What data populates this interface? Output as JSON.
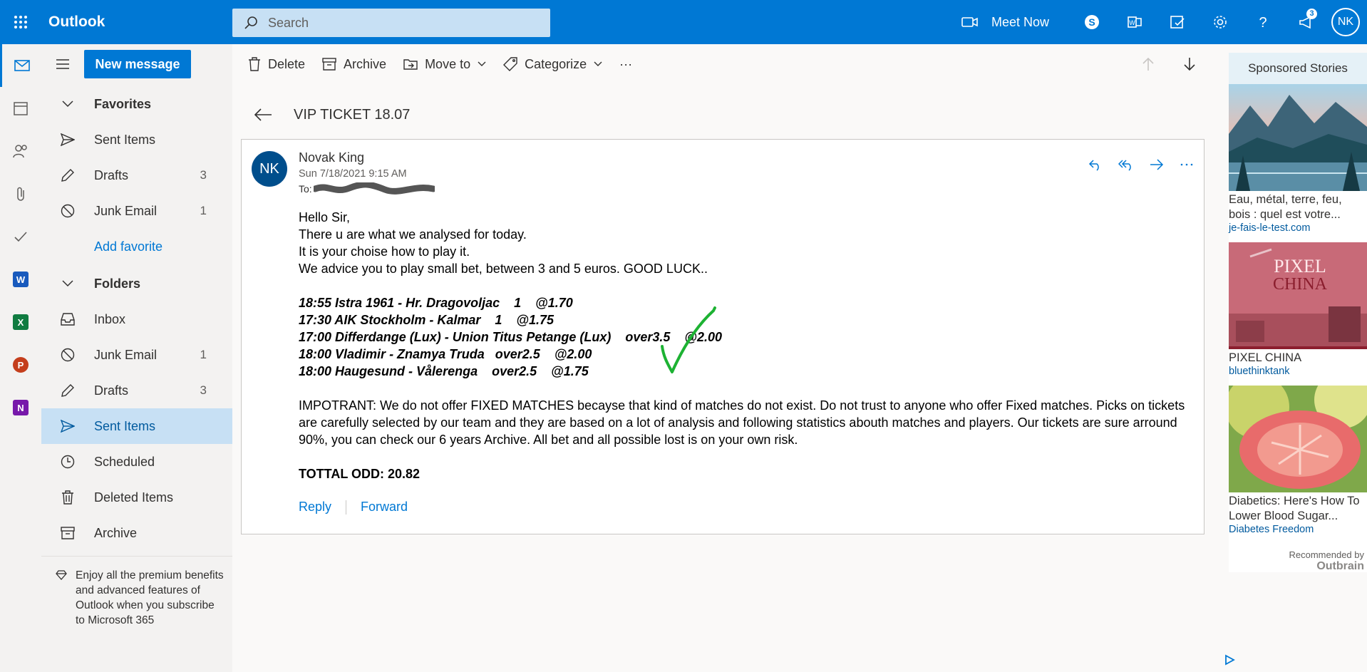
{
  "app": {
    "title": "Outlook"
  },
  "search": {
    "placeholder": "Search"
  },
  "topbar": {
    "meet_now": "Meet Now",
    "notification_count": "3",
    "user_initials": "NK"
  },
  "toolbar": {
    "new_message": "New message",
    "delete": "Delete",
    "archive": "Archive",
    "move_to": "Move to",
    "categorize": "Categorize",
    "more": "···"
  },
  "favorites": {
    "title": "Favorites",
    "items": [
      {
        "label": "Sent Items",
        "count": ""
      },
      {
        "label": "Drafts",
        "count": "3"
      },
      {
        "label": "Junk Email",
        "count": "1"
      }
    ],
    "add_favorite": "Add favorite"
  },
  "folders": {
    "title": "Folders",
    "items": [
      {
        "label": "Inbox",
        "count": ""
      },
      {
        "label": "Junk Email",
        "count": "1"
      },
      {
        "label": "Drafts",
        "count": "3"
      },
      {
        "label": "Sent Items",
        "count": ""
      },
      {
        "label": "Scheduled",
        "count": ""
      },
      {
        "label": "Deleted Items",
        "count": ""
      },
      {
        "label": "Archive",
        "count": ""
      }
    ]
  },
  "premium": {
    "text": "Enjoy all the premium benefits and advanced features of Outlook when you subscribe to Microsoft 365"
  },
  "message": {
    "subject": "VIP TICKET 18.07",
    "sender_initials": "NK",
    "sender": "Novak King",
    "date": "Sun 7/18/2021 9:15 AM",
    "to_label": "To:",
    "greeting": "Hello Sir,",
    "line1": "There u are what we analysed for today.",
    "line2": "It is your choise how to play it.",
    "line3": "We advice you to play small bet, between 3 and 5 euros. GOOD LUCK..",
    "picks": [
      "18:55 Istra 1961 - Hr. Dragovoljac    1    @1.70",
      "17:30 AIK Stockholm - Kalmar    1    @1.75",
      "17:00 Differdange (Lux) - Union Titus Petange (Lux)    over3.5    @2.00",
      "18:00 Vladimir - Znamya Truda   over2.5    @2.00",
      "18:00 Haugesund - Vålerenga    over2.5    @1.75"
    ],
    "important": "IMPOTRANT: We do not offer FIXED MATCHES becayse that kind of matches do not exist. Do not trust to anyone who offer Fixed matches. Picks on tickets are carefully selected by our team and they are based on a lot of analysis and following statistics abouth matches and players. Our tickets are sure arround 90%, you can check our 6 years Archive. All bet and all possible lost is on your own risk.",
    "total": "TOTTAL ODD: 20.82",
    "reply": "Reply",
    "forward": "Forward"
  },
  "ads": {
    "header": "Sponsored Stories",
    "items": [
      {
        "title": "Eau, métal, terre, feu, bois : quel est votre...",
        "source": "je-fais-le-test.com"
      },
      {
        "title": "PIXEL CHINA",
        "source": "bluethinktank",
        "image_text_1": "PIXEL",
        "image_text_2": "CHINA"
      },
      {
        "title": "Diabetics: Here's How To Lower Blood Sugar...",
        "source": "Diabetes Freedom"
      }
    ],
    "recommended": "Recommended by",
    "outbrain": "Outbrain"
  }
}
